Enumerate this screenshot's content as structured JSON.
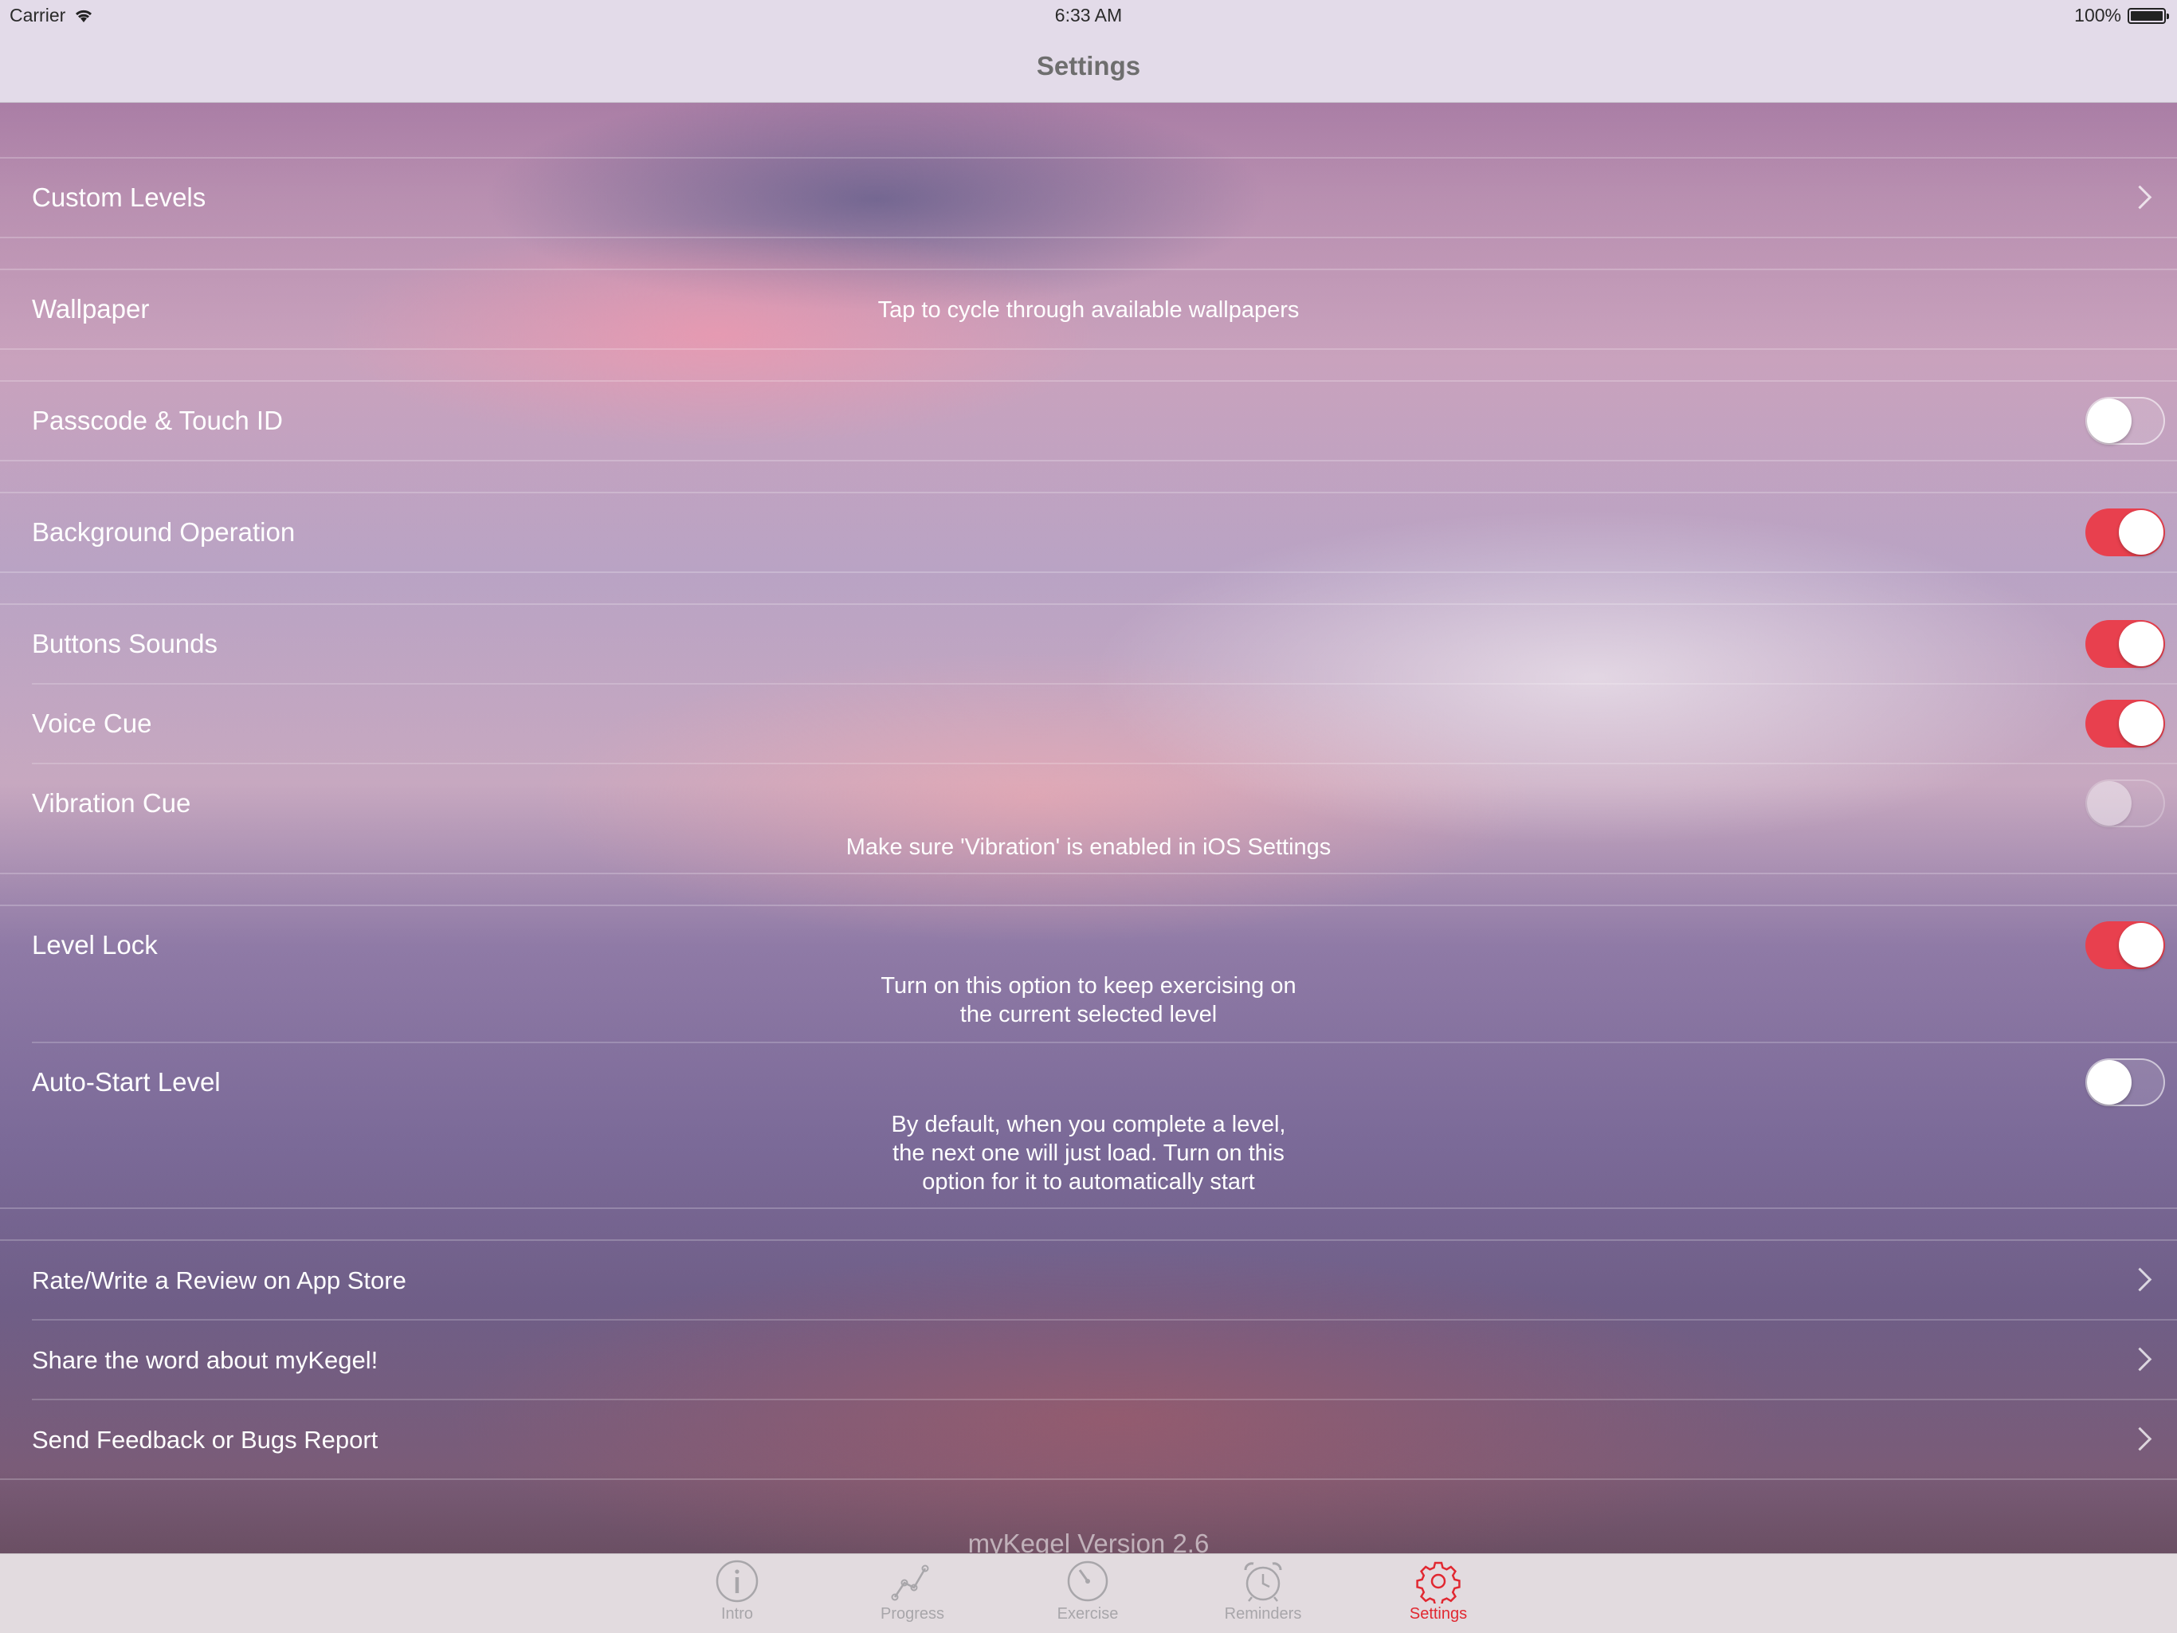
{
  "status_bar": {
    "carrier": "Carrier",
    "time": "6:33 AM",
    "battery": "100%"
  },
  "nav": {
    "title": "Settings"
  },
  "groups": {
    "custom_levels": {
      "label": "Custom Levels"
    },
    "wallpaper": {
      "label": "Wallpaper",
      "note": "Tap to cycle through available wallpapers"
    },
    "passcode": {
      "label": "Passcode & Touch ID",
      "on": false
    },
    "background": {
      "label": "Background Operation",
      "on": true
    },
    "buttons_sounds": {
      "label": "Buttons Sounds",
      "on": true
    },
    "voice_cue": {
      "label": "Voice Cue",
      "on": true
    },
    "vibration_cue": {
      "label": "Vibration Cue",
      "on": false,
      "note": "Make sure 'Vibration' is enabled in iOS Settings"
    },
    "level_lock": {
      "label": "Level Lock",
      "on": true,
      "note_line1": "Turn on this option to keep exercising on",
      "note_line2": "the current selected level"
    },
    "auto_start": {
      "label": "Auto-Start Level",
      "on": false,
      "note_line1": "By default, when you complete a level,",
      "note_line2": "the next one will just load. Turn on this",
      "note_line3": "option for it to automatically start"
    },
    "rate": {
      "label": "Rate/Write a Review on App Store"
    },
    "share": {
      "label": "Share the word about myKegel!"
    },
    "feedback": {
      "label": "Send Feedback or Bugs Report"
    }
  },
  "version": "myKegel Version 2.6",
  "tabs": [
    {
      "label": "Intro",
      "icon": "info-icon"
    },
    {
      "label": "Progress",
      "icon": "progress-chart-icon"
    },
    {
      "label": "Exercise",
      "icon": "timer-dial-icon"
    },
    {
      "label": "Reminders",
      "icon": "alarm-clock-icon"
    },
    {
      "label": "Settings",
      "icon": "gear-icon",
      "active": true
    }
  ],
  "colors": {
    "accent": "#e12831",
    "toggle_on": "#e8404e",
    "bar_bg": "#e3dbe9"
  }
}
